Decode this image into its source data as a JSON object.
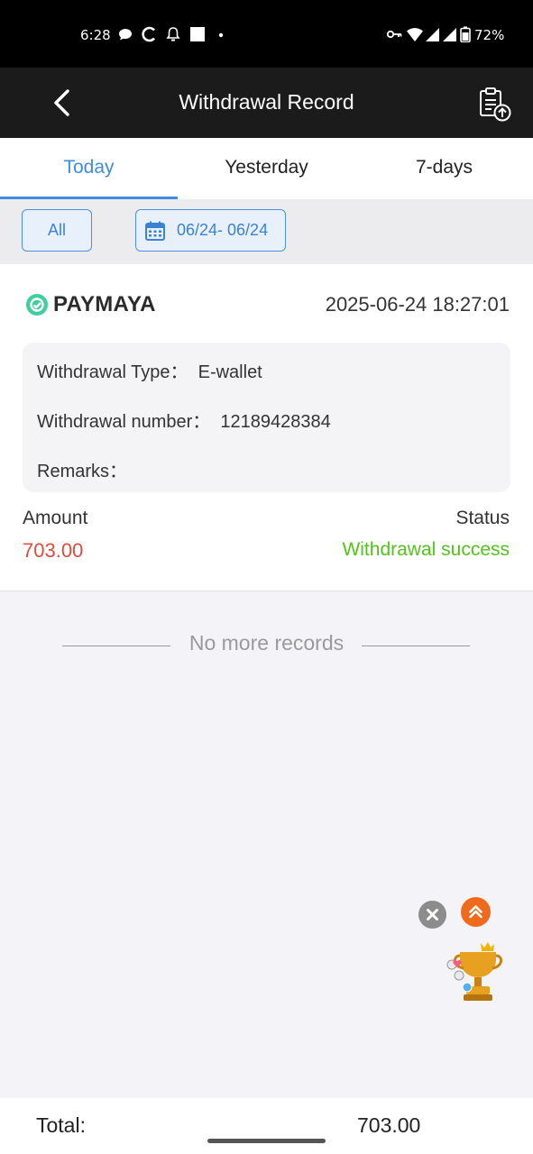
{
  "status_bar": {
    "time": "6:28",
    "battery": "72%"
  },
  "header": {
    "title": "Withdrawal Record"
  },
  "tabs": [
    {
      "label": "Today",
      "active": true
    },
    {
      "label": "Yesterday",
      "active": false
    },
    {
      "label": "7-days",
      "active": false
    }
  ],
  "filters": {
    "all_label": "All",
    "date_range": "06/24- 06/24"
  },
  "record": {
    "brand": "PAYMAYA",
    "datetime": "2025-06-24 18:27:01",
    "type_label": "Withdrawal Type：",
    "type_value": "E-wallet",
    "number_label": "Withdrawal number：",
    "number_value": "12189428384",
    "remarks_label": "Remarks：",
    "amount_label": "Amount",
    "amount_value": "703.00",
    "status_label": "Status",
    "status_value": "Withdrawal success"
  },
  "list_end": "No more records",
  "footer": {
    "total_label": "Total:",
    "total_value": "703.00"
  },
  "colors": {
    "accent": "#3f8de0",
    "amount": "#e24c3a",
    "success": "#52c41a",
    "brand": "#3ecf9a"
  }
}
